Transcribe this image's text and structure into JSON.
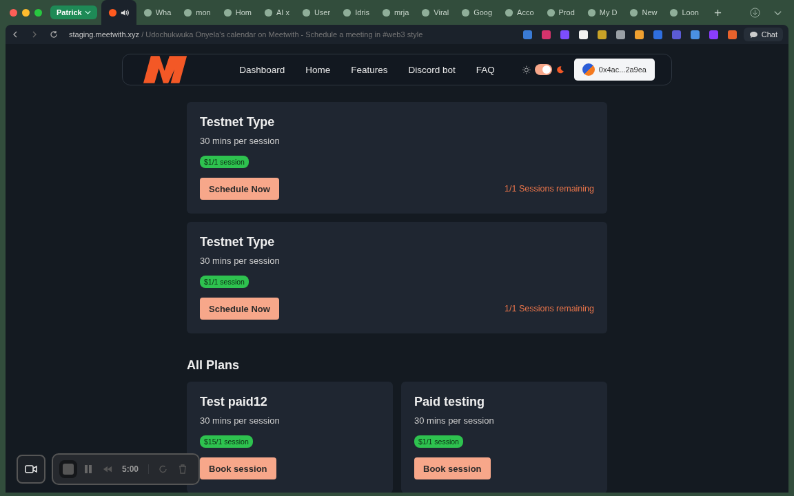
{
  "browser": {
    "tab_group": "Patrick",
    "tabs": [
      {
        "selected": true,
        "audio": true
      },
      {
        "label": "Wha",
        "selected": false,
        "audio": false
      },
      {
        "label": "mon",
        "selected": false,
        "audio": false
      },
      {
        "label": "Hom",
        "selected": false,
        "audio": false
      },
      {
        "label": "AI x",
        "selected": false,
        "audio": false
      },
      {
        "label": "User",
        "selected": false,
        "audio": false
      },
      {
        "label": "Idris",
        "selected": false,
        "audio": false
      },
      {
        "label": "mrja",
        "selected": false,
        "audio": false
      },
      {
        "label": "Viral",
        "selected": false,
        "audio": false
      },
      {
        "label": "Goog",
        "selected": false,
        "audio": false
      },
      {
        "label": "Acco",
        "selected": false,
        "audio": false
      },
      {
        "label": "Prod",
        "selected": false,
        "audio": false
      },
      {
        "label": "My D",
        "selected": false,
        "audio": false
      },
      {
        "label": "New",
        "selected": false,
        "audio": false
      },
      {
        "label": "Loon",
        "selected": false,
        "audio": false
      }
    ],
    "url_host": "staging.meetwith.xyz",
    "url_title": "/ Udochukwuka Onyela's calendar on Meetwith - Schedule a meeting in #web3 style",
    "extensions": [
      {
        "color": "#3a7bd5"
      },
      {
        "color": "#d6336c"
      },
      {
        "color": "#7c4dff"
      },
      {
        "color": "#f1f1f1"
      },
      {
        "color": "#c9a227"
      },
      {
        "color": "#9aa0a6"
      },
      {
        "color": "#f0a030"
      },
      {
        "color": "#2f6fe0"
      },
      {
        "color": "#5b5bd6"
      },
      {
        "color": "#4a90e2"
      },
      {
        "color": "#8b3dff"
      },
      {
        "color": "#e8622c"
      }
    ],
    "chat": "Chat"
  },
  "nav": {
    "links": [
      "Dashboard",
      "Home",
      "Features",
      "Discord bot",
      "FAQ"
    ],
    "dark_mode": true,
    "wallet": "0x4ac...2a9ea"
  },
  "paid_sessions": [
    {
      "title": "Testnet Type",
      "duration": "30 mins per session",
      "price": "$1/1 session",
      "button": "Schedule Now",
      "remaining": "1/1 Sessions remaining"
    },
    {
      "title": "Testnet Type",
      "duration": "30 mins per session",
      "price": "$1/1 session",
      "button": "Schedule Now",
      "remaining": "1/1 Sessions remaining"
    }
  ],
  "all_plans": {
    "heading": "All Plans",
    "plans": [
      {
        "title": "Test paid12",
        "duration": "30 mins per session",
        "price": "$15/1 session",
        "button": "Book session"
      },
      {
        "title": "Paid testing",
        "duration": "30 mins per session",
        "price": "$1/1 session",
        "button": "Book session"
      }
    ]
  },
  "recorder": {
    "time": "5:00"
  }
}
